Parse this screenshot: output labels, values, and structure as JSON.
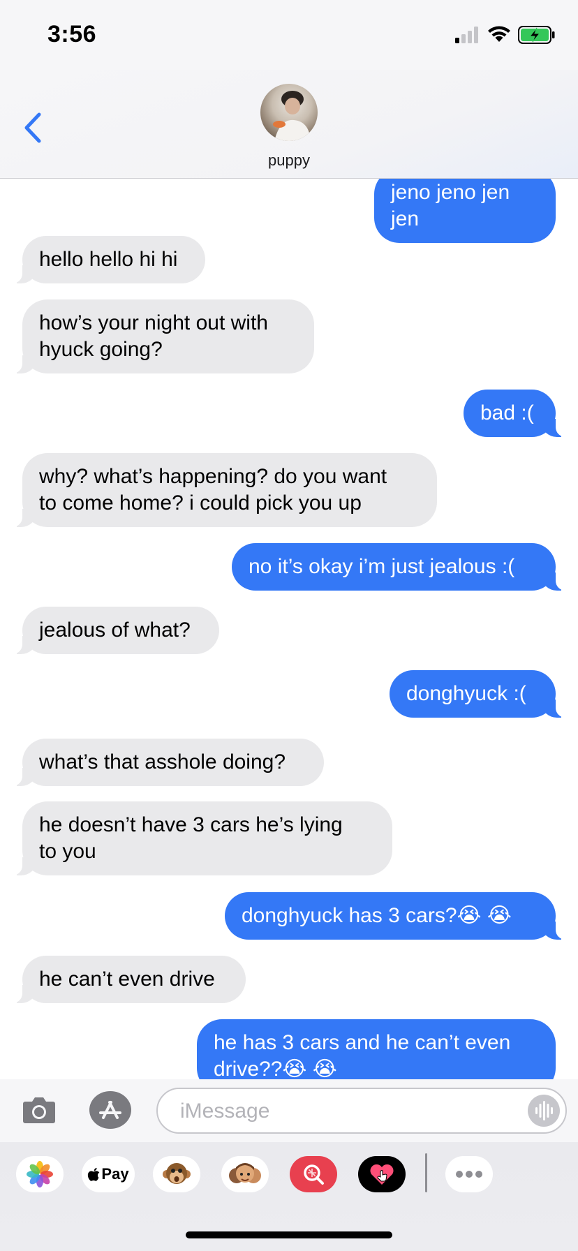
{
  "status": {
    "time": "3:56"
  },
  "contact": {
    "name": "puppy"
  },
  "messages": [
    {
      "from": "me",
      "text": "jeno jeno jen jen"
    },
    {
      "from": "them",
      "text": "hello hello hi hi"
    },
    {
      "from": "them",
      "text": "how’s your night out with\nhyuck going?"
    },
    {
      "from": "me",
      "text": "bad :("
    },
    {
      "from": "them",
      "text": "why? what’s happening? do you want\nto come home? i could pick you up"
    },
    {
      "from": "me",
      "text": "no it’s okay i’m just jealous :("
    },
    {
      "from": "them",
      "text": "jealous of what?"
    },
    {
      "from": "me",
      "text": "donghyuck :("
    },
    {
      "from": "them",
      "text": "what’s that asshole doing?"
    },
    {
      "from": "them",
      "text": "he doesn’t have 3 cars he’s lying\nto you"
    },
    {
      "from": "me",
      "text": "donghyuck has 3 cars?😭 😭"
    },
    {
      "from": "them",
      "text": "he can’t even drive"
    },
    {
      "from": "me",
      "text": "he has 3 cars and he can’t even\ndrive??😭 😭"
    }
  ],
  "composer": {
    "placeholder": "iMessage"
  },
  "apps": [
    {
      "icon": "photos-icon"
    },
    {
      "icon": "apple-pay-icon",
      "label": "Pay"
    },
    {
      "icon": "animoji-monkey-icon"
    },
    {
      "icon": "memoji-icon"
    },
    {
      "icon": "image-search-icon"
    },
    {
      "icon": "digital-touch-icon"
    },
    {
      "icon": "more-icon"
    }
  ],
  "colors": {
    "outgoing": "#3478f6",
    "incoming": "#e9e9eb",
    "accent": "#3478f6"
  }
}
